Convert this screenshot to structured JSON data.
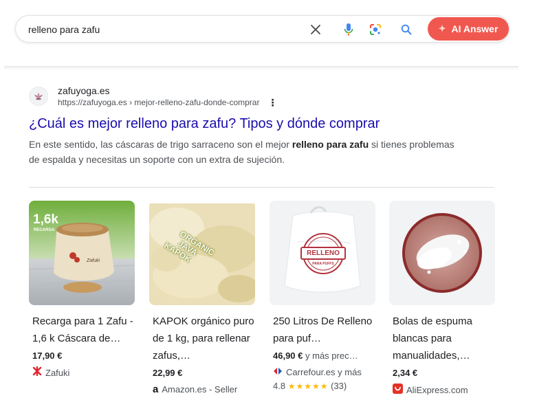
{
  "search": {
    "query": "relleno para zafu",
    "ai_button_label": "AI Answer"
  },
  "result": {
    "site_name": "zafuyoga.es",
    "url": "https://zafuyoga.es › mejor-relleno-zafu-donde-comprar",
    "more_icon": "⋮",
    "title": "¿Cuál es mejor relleno para zafu? Tipos y dónde comprar",
    "snippet": {
      "pre": "En este sentido, las cáscaras de trigo sarraceno son el mejor ",
      "bold": "relleno para zafu",
      "post": " si tienes problemas de espalda y necesitas un soporte con un extra de sujeción."
    }
  },
  "products": [
    {
      "title": "Recarga para 1 Zafu - 1,6 k Cáscara de…",
      "price": "17,90 €",
      "price_extra": "",
      "store": "Zafuki",
      "store_icon": "zafuki-logo-icon",
      "image_badge": "1,6k",
      "image_badge_sub": "RECARGA",
      "image_label": "Zafuki"
    },
    {
      "title": "KAPOK orgánico puro de 1 kg, para rellenar zafus,…",
      "price": "22,99 €",
      "price_extra": "",
      "store": "Amazon.es - Seller",
      "store_icon": "amazon-logo-icon",
      "image_text": [
        "ORGANIC",
        "JAVA",
        "KAPOK"
      ]
    },
    {
      "title": "250 Litros De Relleno para puf…",
      "price": "46,90 €",
      "price_extra": "y más prec…",
      "store": "Carrefour.es y más",
      "store_icon": "carrefour-logo-icon",
      "rating": "4.8",
      "stars": "★★★★★",
      "reviews": "(33)",
      "image_stamp": "RELLENO",
      "image_stamp_sub": "PARA PUFFS"
    },
    {
      "title": "Bolas de espuma blancas para manualidades,…",
      "price": "2,34 €",
      "price_extra": "",
      "store": "AliExpress.com",
      "store_icon": "aliexpress-logo-icon"
    }
  ],
  "colors": {
    "ai_button": "#f0584f",
    "link": "#1a0dab",
    "star": "#fbbc04"
  }
}
